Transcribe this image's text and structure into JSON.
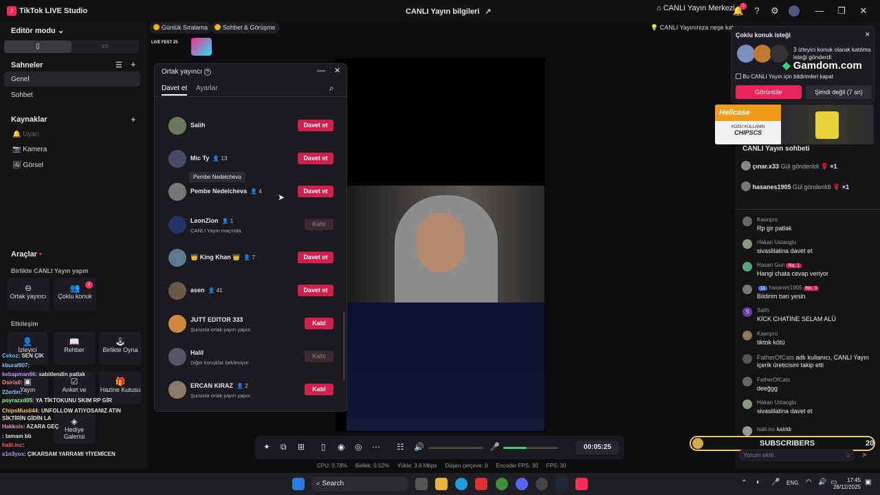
{
  "titlebar": {
    "app_name": "TikTok LIVE Studio",
    "center_title": "CANLI Yayın bilgileri",
    "live_center": "CANLI Yayın Merkezi",
    "notif_count": "1"
  },
  "left": {
    "editor_mode": "Editör modu",
    "scenes_title": "Sahneler",
    "scenes": [
      "Genel",
      "Sohbet"
    ],
    "sources_title": "Kaynaklar",
    "sources": [
      "Uyarı",
      "Kamera",
      "Görsel"
    ],
    "tools_title": "Araçlar",
    "live_together": "Birlikte CANLI Yayın yapın",
    "tool_cohost": "Ortak yayıncı",
    "tool_multiguest": "Çoklu konuk",
    "tool_multiguest_badge": "3",
    "interaction": "Etkileşim",
    "tool_guide": "Rehber",
    "tool_play": "Birlikte Oyna",
    "tool_poll": "Anket ve",
    "tool_treasure": "Hazine Kutusu",
    "tool_gift_gallery": "Hediye Galerisi",
    "tool_live": "Yayın",
    "tool_viewer": "İzleyici"
  },
  "chips": {
    "daily_ranking": "Günlük Sıralama",
    "chat_meet": "Sohbet & Görüşme",
    "fun_hint": "CANLI Yayınınıza neşe katın"
  },
  "livefest": "LIVE FEST 25",
  "dialog": {
    "title": "Ortak yayıncı",
    "tab_invite": "Davet et",
    "tab_settings": "Ayarlar",
    "tooltip": "Pembe Nedelcheva",
    "hosts": [
      {
        "name": "Salih",
        "count": "",
        "sub": "",
        "btn": "Davet et"
      },
      {
        "name": "Mic Ty",
        "count": "13",
        "sub": "",
        "btn": "Davet et"
      },
      {
        "name": "Pembe Nedelcheva",
        "count": "4",
        "sub": "",
        "btn": "Davet et"
      },
      {
        "name": "LeonZion",
        "count": "1",
        "sub": "CANLI Yayın maçında",
        "btn": "Katıl"
      },
      {
        "name": "👑 King Khan 👑",
        "count": "7",
        "sub": "",
        "btn": "Davet et"
      },
      {
        "name": "asen",
        "count": "41",
        "sub": "",
        "btn": "Davet et"
      },
      {
        "name": "JUTT EDITOR 333",
        "count": "",
        "sub": "Şununla ortak yayın yapın:",
        "btn": "Katıl"
      },
      {
        "name": "Halil",
        "count": "",
        "sub": "Diğer konuklar bekleniyor",
        "btn": "Katıl"
      },
      {
        "name": "ERCAN KIRAZ",
        "count": "2",
        "sub": "Şununla ortak yayın yapın:",
        "btn": "Katıl"
      }
    ]
  },
  "controls": {
    "timer": "00:05:25"
  },
  "stats": {
    "cpu": "CPU: 0.78%",
    "mem": "Bellek: 0.52%",
    "upload": "Yükle: 3.6 Mbps",
    "dropped": "Düşen çerçeve: 0",
    "encoder_fps": "Encoder FPS: 30",
    "fps": "FPS: 30"
  },
  "guest_request": {
    "title": "Çoklu konuk isteği",
    "message": "3 izleyici konuk olarak katılma isteği gönderdi",
    "checkbox": "Bu CANLI Yayın için bildirimleri kapat",
    "view_btn": "Görüntüle",
    "later_btn": "Şimdi değil (7 sn)"
  },
  "ads": {
    "gamdom": "Gamdom.com",
    "hellcase": "Hellcase",
    "hellcase_code_label": "KODU KULLANIN",
    "hellcase_code": "CHIPSCS"
  },
  "livechat": {
    "title": "CANLI Yayın sohbeti",
    "gifts": [
      {
        "user": "çınar.x33",
        "text": "Gül gönderildi",
        "qty": "×1"
      },
      {
        "user": "hasanes1905",
        "text": "Gül gönderildi",
        "qty": "×1"
      }
    ],
    "messages": [
      {
        "user": "Kaanpro",
        "text": "Rp gir patlak",
        "badge": ""
      },
      {
        "user": "Hakan Ustaoglu",
        "text": "sivaslilatina davet et",
        "badge": ""
      },
      {
        "user": "Hasan Gun",
        "text": "Hangi chata cevap veriyor",
        "badge": "No. 1"
      },
      {
        "user": "hasanes1905",
        "text": "Bildirim ban yesin",
        "badge": "No. 3",
        "level": "11"
      },
      {
        "user": "Salih",
        "text": "KİCK CHATİNE SELAM ALÜ",
        "badge": ""
      },
      {
        "user": "Kaanpro",
        "text": "tiktok kötü",
        "badge": ""
      },
      {
        "user": "FatherOfCats",
        "text": "adlı kullanıcı, CANLI Yayın içerik üreticisini takip etti",
        "badge": ""
      },
      {
        "user": "FatherOfCats",
        "text": "deeğgg",
        "badge": ""
      },
      {
        "user": "Hakan Ustaoglu",
        "text": "sivaslilatina davet et",
        "badge": ""
      },
      {
        "user": "halil.inc",
        "text": "katıldı",
        "badge": ""
      }
    ],
    "input_placeholder": "Yorum ekle"
  },
  "subscribers": {
    "label": "SUBSCRIBERS",
    "count": "20"
  },
  "overlay_chat": [
    {
      "user": "Cekoz",
      "text": ": SEN ÇIK"
    },
    {
      "user": "kbural907",
      "text": ":"
    },
    {
      "user": "kebapman66",
      "text": ": sabitlendin patlak"
    },
    {
      "user": "Osiris0",
      "text": ":"
    },
    {
      "user": "22ertin",
      "text": ":"
    },
    {
      "user": "poyrazxd05",
      "text": ": YA TİKTOKUNU SKIM RP GİR"
    },
    {
      "user": "ChipsMusti44",
      "text": ": UNFOLLOW ATIYOSANIZ ATIN SİKTİRİN GİDİN LA"
    },
    {
      "user": "Hakkois",
      "text": ": AZARA GEÇ"
    },
    {
      "user": "",
      "text": ": tamam bb"
    },
    {
      "user": "halil.inc",
      "text": ":"
    },
    {
      "user": "s1n3yox",
      "text": ": ÇIKARSAM YARRAMI YİYEMİCEN"
    }
  ],
  "taskbar": {
    "search": "Search",
    "lang": "ENG",
    "time": "17:45",
    "date": "28/12/2025"
  }
}
